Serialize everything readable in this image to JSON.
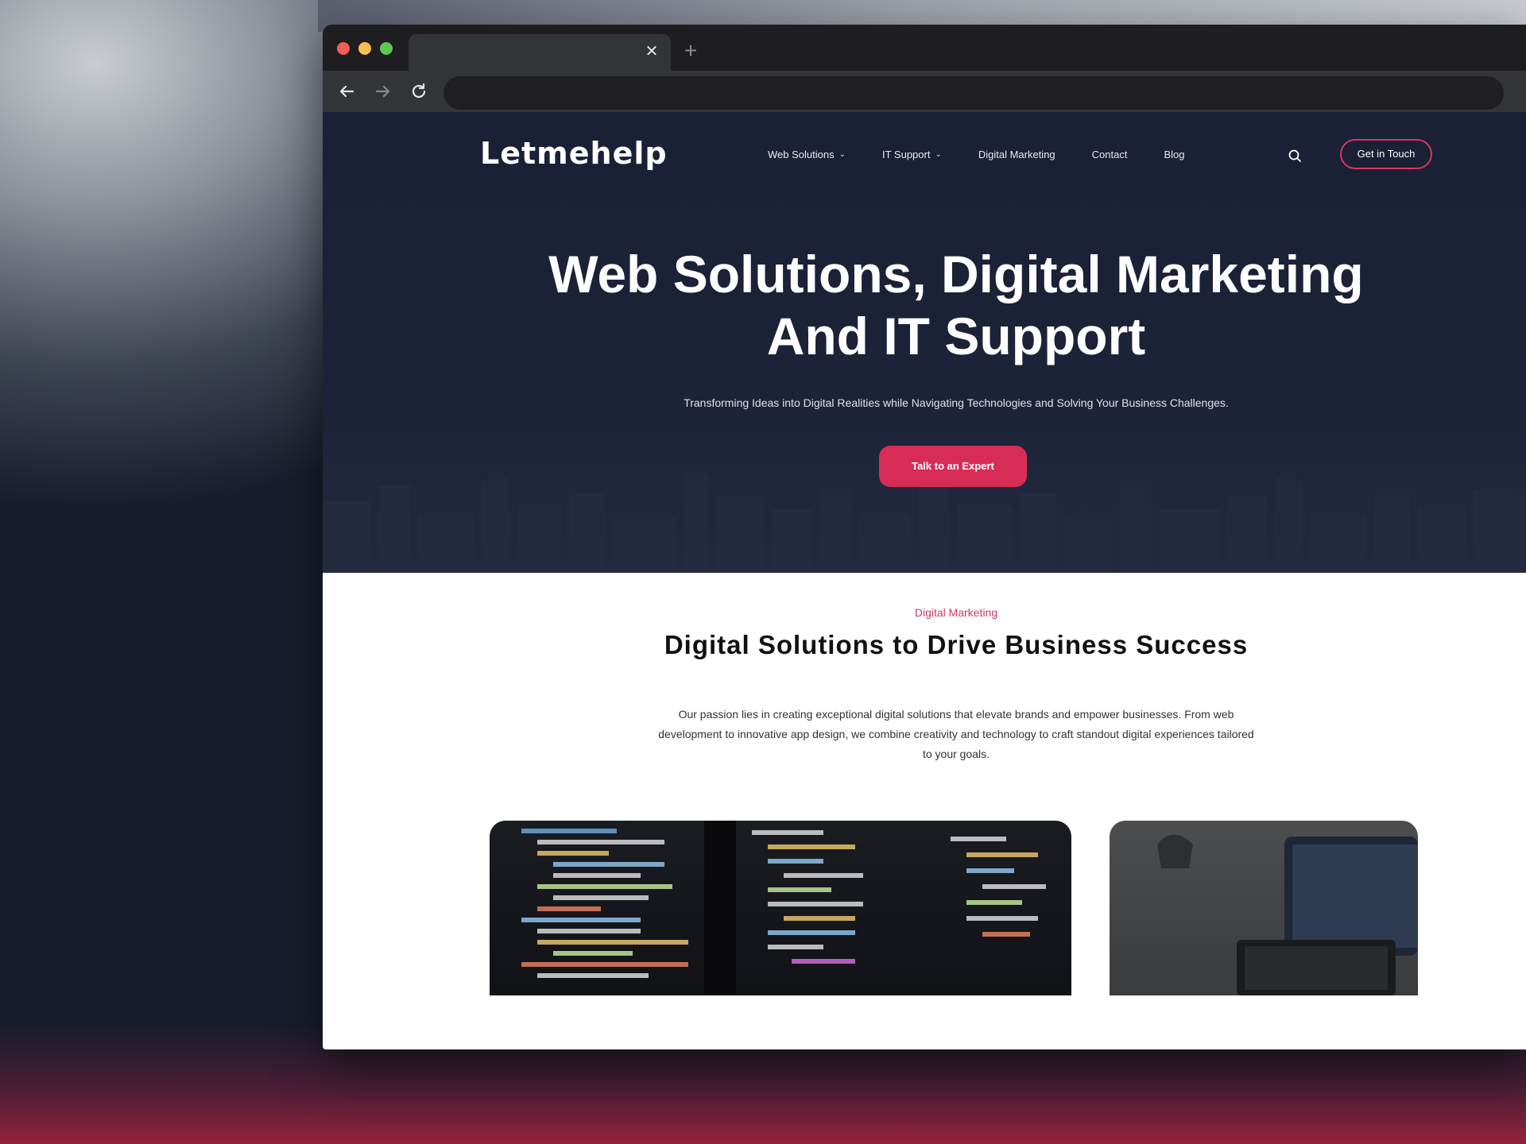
{
  "browser": {
    "tab_title": "",
    "tab_close": "✕",
    "new_tab": "+",
    "url": ""
  },
  "site": {
    "logo": "Letmehelp",
    "nav": [
      {
        "label": "Web Solutions",
        "has_dropdown": true
      },
      {
        "label": "IT Support",
        "has_dropdown": true
      },
      {
        "label": "Digital Marketing",
        "has_dropdown": false
      },
      {
        "label": "Contact",
        "has_dropdown": false
      },
      {
        "label": "Blog",
        "has_dropdown": false
      }
    ],
    "cta_label": "Get in Touch"
  },
  "hero": {
    "title_line1": "Web Solutions, Digital Marketing",
    "title_line2": "And IT Support",
    "subtitle": "Transforming Ideas into Digital Realities while Navigating Technologies and Solving Your Business Challenges.",
    "button_label": "Talk to an Expert"
  },
  "section": {
    "eyebrow": "Digital Marketing",
    "title": "Digital Solutions to Drive Business Success",
    "body": "Our passion lies in creating exceptional digital solutions that elevate brands and empower businesses. From web development to innovative app design, we combine creativity and technology to craft standout digital experiences tailored to your goals."
  },
  "colors": {
    "accent": "#d72c57",
    "hero_bg": "#1c2237",
    "eyebrow": "#c83a60"
  },
  "icons": {
    "back": "arrow-left-icon",
    "forward": "arrow-right-icon",
    "reload": "reload-icon",
    "search": "search-icon",
    "chevron": "chevron-down-icon"
  }
}
